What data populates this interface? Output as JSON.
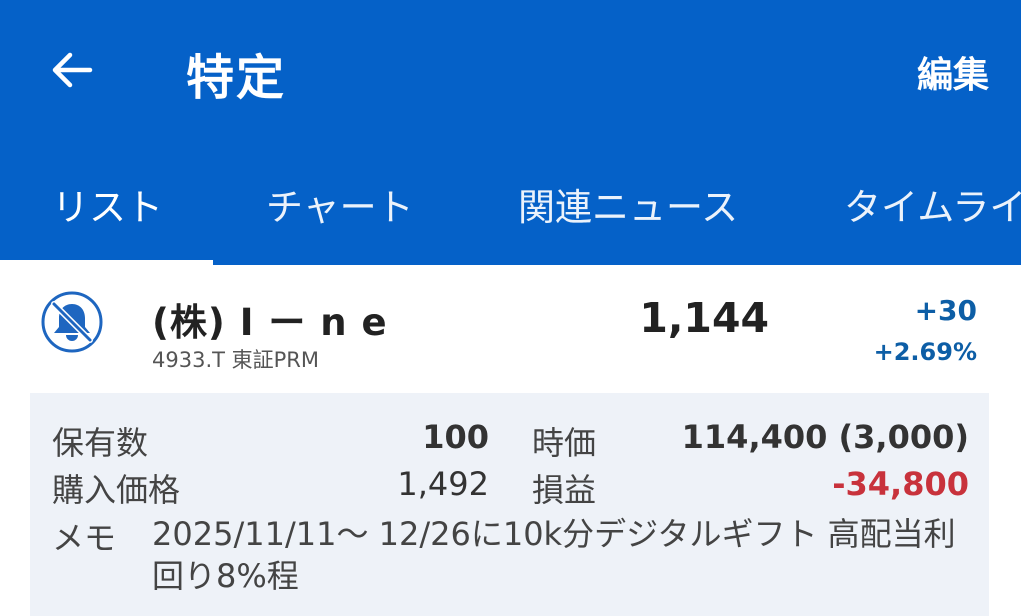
{
  "header": {
    "title": "特定",
    "edit_label": "編集",
    "bg_color": "#0561c8"
  },
  "tabs": [
    {
      "label": "リスト",
      "active": true
    },
    {
      "label": "チャート",
      "active": false
    },
    {
      "label": "関連ニュース",
      "active": false
    },
    {
      "label": "タイムライン",
      "active": false
    }
  ],
  "stock": {
    "name": "(株) I ー n e",
    "code_market": "4933.T 東証PRM",
    "price": "1,144",
    "change": "+30",
    "change_pct": "+2.69%",
    "icon": "bell-off-icon",
    "change_color": "#0d5ea6"
  },
  "holdings": {
    "shares_label": "保有数",
    "shares_value": "100",
    "market_value_label": "時価",
    "market_value": "114,400 (3,000)",
    "purchase_price_label": "購入価格",
    "purchase_price_value": "1,492",
    "pnl_label": "損益",
    "pnl_value": "-34,800",
    "pnl_color": "#c8323c",
    "memo_label": "メモ",
    "memo_text": "2025/11/11～ 12/26に10k分デジタルギフト 高配当利回り8%程"
  }
}
